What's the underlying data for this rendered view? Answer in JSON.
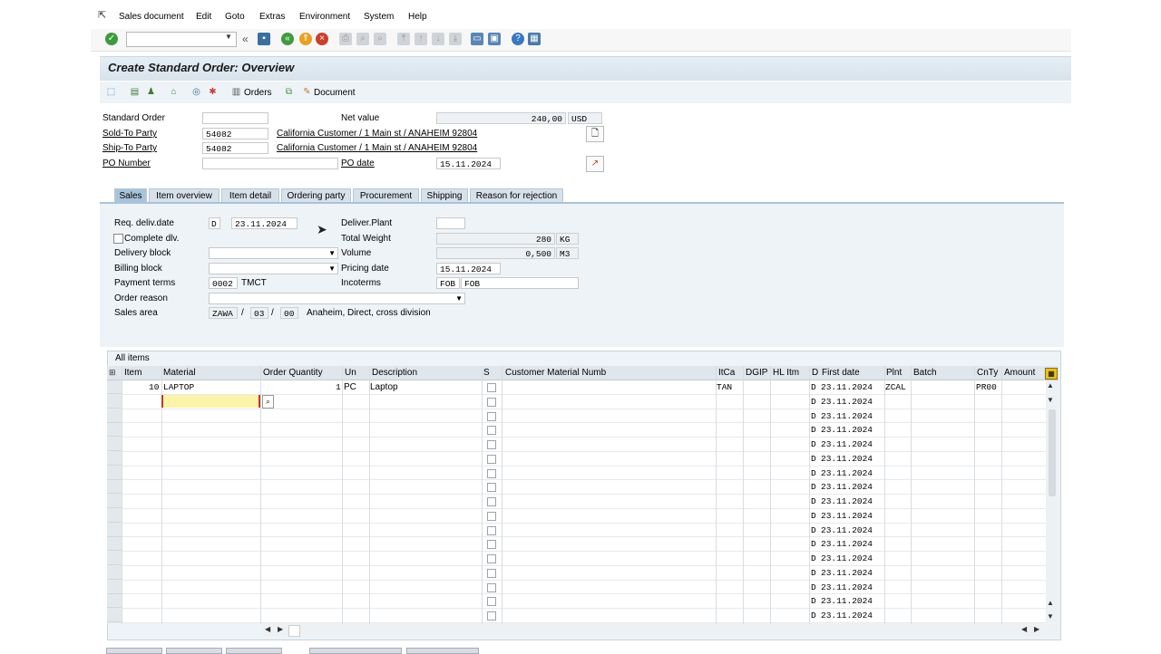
{
  "menubar": {
    "items": [
      {
        "label": "Sales document"
      },
      {
        "label": "Edit"
      },
      {
        "label": "Goto"
      },
      {
        "label": "Extras"
      },
      {
        "label": "Environment"
      },
      {
        "label": "System"
      },
      {
        "label": "Help"
      }
    ]
  },
  "toolbar": {
    "command_field_value": "",
    "back_chevron": "«"
  },
  "title": "Create Standard Order: Overview",
  "app_toolbar": {
    "orders_label": "Orders",
    "document_label": "Document"
  },
  "header": {
    "standard_order_label": "Standard Order",
    "standard_order_value": "",
    "net_value_label": "Net value",
    "net_value": "240,00",
    "currency": "USD",
    "sold_to_label": "Sold-To Party",
    "sold_to_value": "54082",
    "sold_to_desc": "California Customer / 1 Main st / ANAHEIM 92804",
    "ship_to_label": "Ship-To Party",
    "ship_to_value": "54082",
    "ship_to_desc": "California Customer / 1 Main st / ANAHEIM 92804",
    "po_number_label": "PO Number",
    "po_number_value": "",
    "po_date_label": "PO date",
    "po_date_value": "15.11.2024"
  },
  "tabs": [
    {
      "label": "Sales",
      "active": true
    },
    {
      "label": "Item overview"
    },
    {
      "label": "Item detail"
    },
    {
      "label": "Ordering party"
    },
    {
      "label": "Procurement"
    },
    {
      "label": "Shipping"
    },
    {
      "label": "Reason for rejection"
    }
  ],
  "sales_tab": {
    "req_deliv_label": "Req. deliv.date",
    "req_deliv_format": "D",
    "req_deliv_value": "23.11.2024",
    "deliver_plant_label": "Deliver.Plant",
    "deliver_plant_value": "",
    "complete_dlv_label": "Complete dlv.",
    "total_weight_label": "Total Weight",
    "total_weight_value": "280",
    "weight_unit": "KG",
    "delivery_block_label": "Delivery block",
    "delivery_block_value": "",
    "volume_label": "Volume",
    "volume_value": "0,500",
    "volume_unit": "M3",
    "billing_block_label": "Billing block",
    "billing_block_value": "",
    "pricing_date_label": "Pricing date",
    "pricing_date_value": "15.11.2024",
    "payment_terms_label": "Payment terms",
    "payment_terms_value": "0002",
    "payment_terms_desc": "TMCT",
    "incoterms_label": "Incoterms",
    "incoterms_code": "FOB",
    "incoterms_desc": "FOB",
    "order_reason_label": "Order reason",
    "order_reason_value": "",
    "sales_area_label": "Sales area",
    "sales_org": "ZAWA",
    "dist_channel": "03",
    "division": "00",
    "sep": "/",
    "sales_area_desc": "Anaheim, Direct, cross division"
  },
  "items_table": {
    "title": "All items",
    "columns": [
      "Item",
      "Material",
      "Order Quantity",
      "Un",
      "Description",
      "S",
      "Customer Material Numb",
      "ItCa",
      "DGIP",
      "HL Itm",
      "D",
      "First date",
      "Plnt",
      "Batch",
      "CnTy",
      "Amount"
    ],
    "first_row": {
      "item": "10",
      "material": "LAPTOP",
      "quantity": "1",
      "unit": "PC",
      "description": "Laptop",
      "itca": "TAN",
      "d": "D",
      "first_date": "23.11.2024",
      "plant": "ZCAL",
      "cnty": "PR00"
    },
    "empty_row_d": "D",
    "empty_row_date": "23.11.2024"
  }
}
